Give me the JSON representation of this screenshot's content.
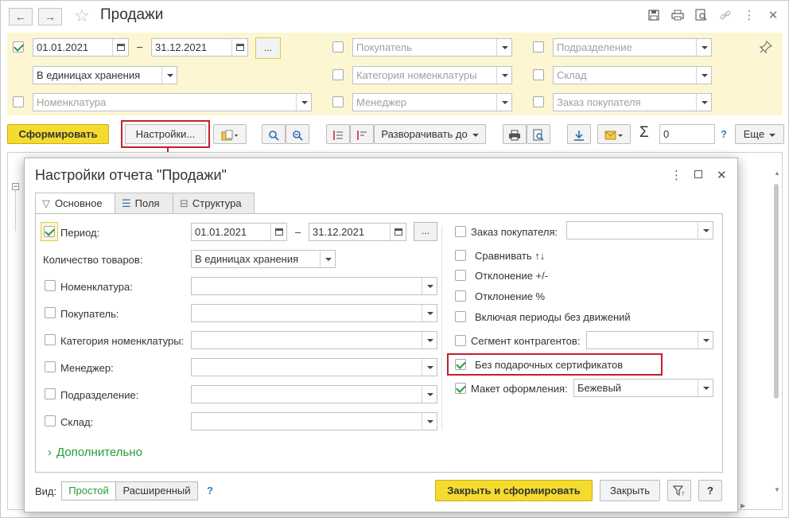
{
  "window": {
    "title": "Продажи",
    "back_label": "←",
    "forward_label": "→"
  },
  "filters": {
    "date_from": "01.01.2021",
    "date_to": "31.12.2021",
    "dash": "–",
    "dots": "...",
    "units": "В единицах хранения",
    "nomenclature_ph": "Номенклатура",
    "buyer_ph": "Покупатель",
    "category_ph": "Категория номенклатуры",
    "manager_ph": "Менеджер",
    "division_ph": "Подразделение",
    "warehouse_ph": "Склад",
    "order_ph": "Заказ покупателя"
  },
  "toolbar": {
    "generate": "Сформировать",
    "settings": "Настройки...",
    "expand": "Разворачивать до",
    "sum_value": "0",
    "more": "Еще",
    "help": "?"
  },
  "dialog": {
    "title": "Настройки отчета \"Продажи\"",
    "tabs": [
      "Основное",
      "Поля",
      "Структура"
    ],
    "left": {
      "period": "Период:",
      "date_from": "01.01.2021",
      "date_to": "31.12.2021",
      "dash": "–",
      "dots": "...",
      "qty_label": "Количество товаров:",
      "qty_value": "В единицах хранения",
      "nomenclature": "Номенклатура:",
      "buyer": "Покупатель:",
      "category": "Категория номенклатуры:",
      "manager": "Менеджер:",
      "division": "Подразделение:",
      "warehouse": "Склад:"
    },
    "right": {
      "order": "Заказ покупателя:",
      "compare": "Сравнивать ↑↓",
      "deviation_abs": "Отклонение +/-",
      "deviation_pct": "Отклонение %",
      "include_periods": "Включая периоды без движений",
      "segment": "Сегмент контрагентов:",
      "no_gift": "Без подарочных сертификатов",
      "layout_label": "Макет оформления:",
      "layout_value": "Бежевый"
    },
    "more": "Дополнительно",
    "view_label": "Вид:",
    "view_simple": "Простой",
    "view_extended": "Расширенный",
    "help": "?",
    "close_generate": "Закрыть и сформировать",
    "close": "Закрыть",
    "help_btn": "?"
  },
  "colors": {
    "accent_yellow": "#f5db2e",
    "filter_bg": "#fcf6d2",
    "highlight_red": "#c5202b",
    "check_green": "#2b9a3f"
  }
}
